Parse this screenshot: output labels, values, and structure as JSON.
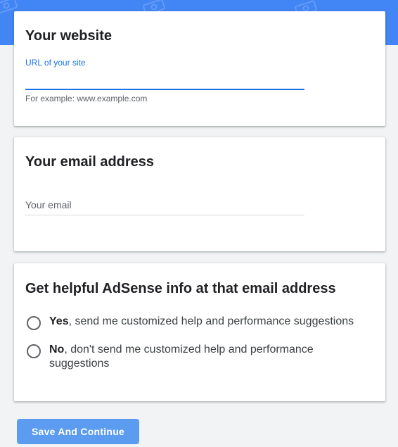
{
  "website_card": {
    "title": "Your website",
    "field_label": "URL of your site",
    "value": "",
    "helper": "For example: www.example.com"
  },
  "email_card": {
    "title": "Your email address",
    "placeholder": "Your email",
    "value": ""
  },
  "info_card": {
    "title": "Get helpful AdSense info at that email address",
    "options": [
      {
        "bold": "Yes",
        "text": ", send me customized help and performance suggestions"
      },
      {
        "bold": "No",
        "text": ", don't send me customized help and performance suggestions"
      }
    ]
  },
  "footer": {
    "save_label": "Save And Continue"
  },
  "colors": {
    "header_band": "#4285f4",
    "accent": "#1a73e8",
    "button": "#5b9cf0",
    "page_background": "#f1f3f4"
  },
  "icons": [
    "money-bill-icon"
  ]
}
